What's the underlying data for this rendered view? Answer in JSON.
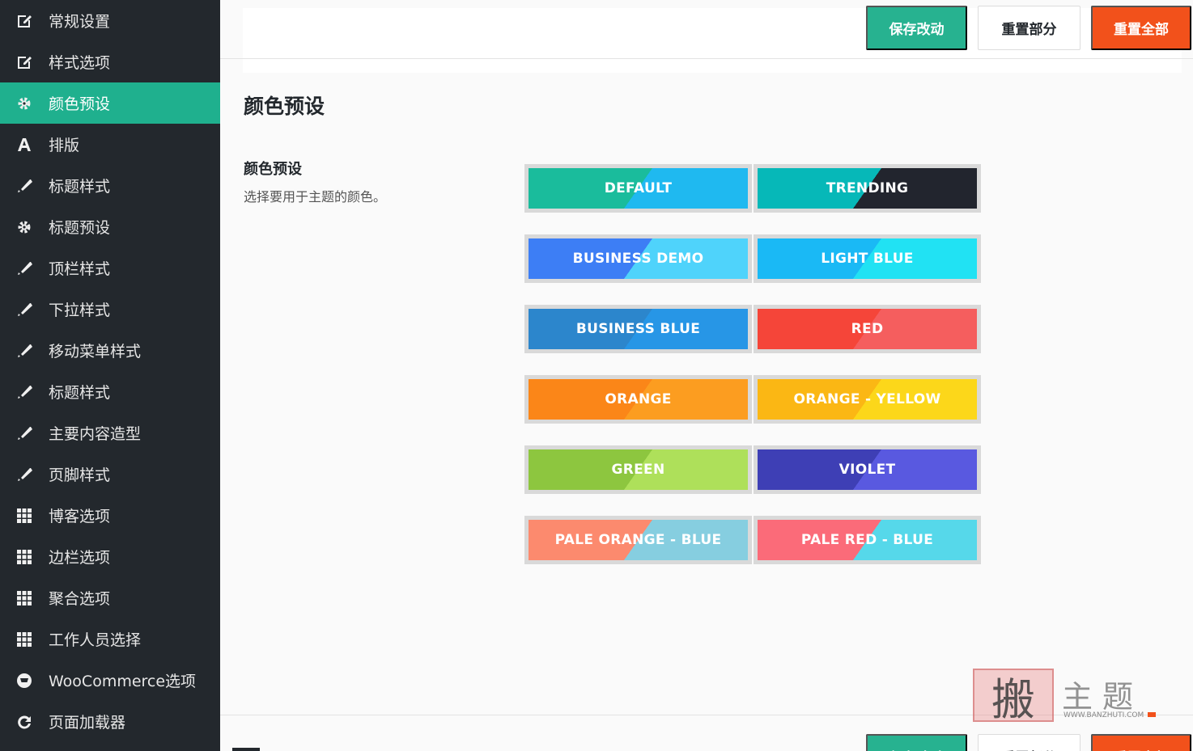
{
  "sidebar": {
    "items": [
      {
        "label": "常规设置",
        "icon": "edit-icon",
        "active": false
      },
      {
        "label": "样式选项",
        "icon": "edit-icon",
        "active": false
      },
      {
        "label": "颜色预设",
        "icon": "gear-icon",
        "active": true
      },
      {
        "label": "排版",
        "icon": "font-icon",
        "active": false
      },
      {
        "label": "标题样式",
        "icon": "brush-icon",
        "active": false
      },
      {
        "label": "标题预设",
        "icon": "gear-icon",
        "active": false
      },
      {
        "label": "顶栏样式",
        "icon": "brush-icon",
        "active": false
      },
      {
        "label": "下拉样式",
        "icon": "brush-icon",
        "active": false
      },
      {
        "label": "移动菜单样式",
        "icon": "brush-icon",
        "active": false
      },
      {
        "label": "标题样式",
        "icon": "brush-icon",
        "active": false
      },
      {
        "label": "主要内容造型",
        "icon": "brush-icon",
        "active": false
      },
      {
        "label": "页脚样式",
        "icon": "brush-icon",
        "active": false
      },
      {
        "label": "博客选项",
        "icon": "grid-icon",
        "active": false
      },
      {
        "label": "边栏选项",
        "icon": "grid-icon",
        "active": false
      },
      {
        "label": "聚合选项",
        "icon": "grid-icon",
        "active": false
      },
      {
        "label": "工作人员选择",
        "icon": "grid-icon",
        "active": false
      },
      {
        "label": "WooCommerce选项",
        "icon": "cart-icon",
        "active": false
      },
      {
        "label": "页面加载器",
        "icon": "refresh-icon",
        "active": false
      }
    ]
  },
  "toolbar": {
    "save_label": "保存改动",
    "reset_section_label": "重置部分",
    "reset_all_label": "重置全部"
  },
  "section": {
    "title": "颜色预设",
    "field_label": "颜色预设",
    "field_description": "选择要用于主题的颜色。"
  },
  "presets": [
    {
      "label": "DEFAULT",
      "color_a": "#1abc9c",
      "color_b": "#1fb9f0"
    },
    {
      "label": "TRENDING",
      "color_a": "#06b8b8",
      "color_b": "#22252e"
    },
    {
      "label": "BUSINESS DEMO",
      "color_a": "#3d7ef5",
      "color_b": "#4fd3fb"
    },
    {
      "label": "LIGHT BLUE",
      "color_a": "#1ab9f5",
      "color_b": "#21e2f3"
    },
    {
      "label": "BUSINESS BLUE",
      "color_a": "#2c86cc",
      "color_b": "#2796e6"
    },
    {
      "label": "RED",
      "color_a": "#f54539",
      "color_b": "#f55e5e"
    },
    {
      "label": "ORANGE",
      "color_a": "#fb8618",
      "color_b": "#fc9d20"
    },
    {
      "label": "ORANGE - YELLOW",
      "color_a": "#fbb714",
      "color_b": "#fcd71a"
    },
    {
      "label": "GREEN",
      "color_a": "#8dc63f",
      "color_b": "#aee05a"
    },
    {
      "label": "VIOLET",
      "color_a": "#3e3fb5",
      "color_b": "#5959e0"
    },
    {
      "label": "PALE ORANGE - BLUE",
      "color_a": "#fc8a6e",
      "color_b": "#86cee0"
    },
    {
      "label": "PALE RED - BLUE",
      "color_a": "#fb6b79",
      "color_b": "#56d8ea"
    }
  ],
  "footer": {
    "save_label": "保存改动",
    "reset_section_label": "重置部分",
    "reset_all_label": "重置全部"
  },
  "watermark": {
    "seal": "搬",
    "text": "主题",
    "url": "WWW.BANZHUTI.COM"
  },
  "colors": {
    "sidebar_bg": "#23282d",
    "accent": "#1fb08e",
    "danger": "#f2511b"
  }
}
